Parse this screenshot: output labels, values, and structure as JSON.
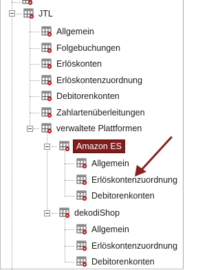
{
  "tree": {
    "root_label": "JTL",
    "root_children": [
      {
        "label": "Allgemein",
        "icon": "table-settings-icon"
      },
      {
        "label": "Folgebuchungen",
        "icon": "table-settings-icon"
      },
      {
        "label": "Erlöskonten",
        "icon": "table-settings-icon"
      },
      {
        "label": "Erlöskontenzuordnung",
        "icon": "table-settings-icon"
      },
      {
        "label": "Debitorenkonten",
        "icon": "table-settings-icon"
      },
      {
        "label": "Zahlartenüberleitungen",
        "icon": "table-settings-icon"
      }
    ],
    "platforms": {
      "label": "verwaltete Plattformen",
      "items": [
        {
          "label": "Amazon ES",
          "selected": true,
          "children": [
            "Allgemein",
            "Erlöskontenzuordnung",
            "Debitorenkonten"
          ]
        },
        {
          "label": "dekodiShop",
          "selected": false,
          "children": [
            "Allgemein",
            "Erlöskontenzuordnung",
            "Debitorenkonten"
          ]
        }
      ]
    }
  },
  "colors": {
    "selection": "#7f1d1d",
    "arrow": "#8b2020",
    "icon_badge": "#c0202b"
  }
}
